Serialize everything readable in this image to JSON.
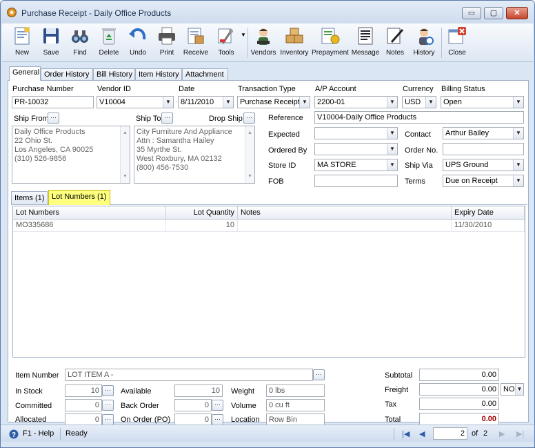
{
  "window": {
    "title": "Purchase Receipt - Daily Office Products",
    "min": "▭",
    "max": "▢",
    "close": "✕"
  },
  "toolbar": [
    {
      "label": "New",
      "icon": "new-document-icon"
    },
    {
      "label": "Save",
      "icon": "floppy-disk-icon"
    },
    {
      "label": "Find",
      "icon": "binoculars-icon"
    },
    {
      "label": "Delete",
      "icon": "recycle-bin-icon"
    },
    {
      "label": "Undo",
      "icon": "undo-arrow-icon"
    },
    {
      "label": "Print",
      "icon": "printer-icon"
    },
    {
      "label": "Receive",
      "icon": "receive-icon"
    },
    {
      "label": "Tools",
      "icon": "tools-icon"
    },
    {
      "label": "Vendors",
      "icon": "vendor-person-icon"
    },
    {
      "label": "Inventory",
      "icon": "boxes-icon"
    },
    {
      "label": "Prepayment",
      "icon": "prepayment-icon"
    },
    {
      "label": "Message",
      "icon": "message-icon"
    },
    {
      "label": "Notes",
      "icon": "notes-pen-icon"
    },
    {
      "label": "History",
      "icon": "history-person-icon"
    },
    {
      "label": "Close",
      "icon": "close-window-icon"
    }
  ],
  "tabs": [
    "General",
    "Order History",
    "Bill History",
    "Item History",
    "Attachment"
  ],
  "header": {
    "purchase_number_label": "Purchase Number",
    "purchase_number": "PR-10032",
    "vendor_id_label": "Vendor ID",
    "vendor_id": "V10004",
    "date_label": "Date",
    "date": "8/11/2010",
    "transaction_type_label": "Transaction Type",
    "transaction_type": "Purchase Receipt",
    "ap_account_label": "A/P Account",
    "ap_account": "2200-01",
    "currency_label": "Currency",
    "currency": "USD",
    "billing_status_label": "Billing Status",
    "billing_status": "Open"
  },
  "ship_from": {
    "label": "Ship From",
    "lines": [
      "Daily Office Products",
      "22 Ohio St.",
      "Los Angeles, CA 90025",
      "(310) 526-9856"
    ]
  },
  "ship_to": {
    "label": "Ship To",
    "lines": [
      "City Furniture And Appliance",
      "Attn : Samantha Hailey",
      "35 Myrthe St.",
      "West Roxbury, MA 02132",
      "(800) 456-7530"
    ]
  },
  "drop_ship_label": "Drop Ship",
  "details": {
    "reference_label": "Reference",
    "reference": "V10004-Daily Office Products",
    "expected_label": "Expected",
    "expected": "",
    "ordered_by_label": "Ordered By",
    "ordered_by": "",
    "store_id_label": "Store ID",
    "store_id": "MA STORE",
    "fob_label": "FOB",
    "fob": "",
    "contact_label": "Contact",
    "contact": "Arthur Bailey",
    "order_no_label": "Order No.",
    "order_no": "",
    "ship_via_label": "Ship Via",
    "ship_via": "UPS Ground",
    "terms_label": "Terms",
    "terms": "Due on Receipt"
  },
  "subtabs": [
    "Items (1)",
    "Lot Numbers (1)"
  ],
  "grid": {
    "columns": [
      "Lot Numbers",
      "Lot Quantity",
      "Notes",
      "Expiry Date"
    ],
    "rows": [
      [
        "MO335686",
        "10",
        "",
        "11/30/2010"
      ]
    ]
  },
  "item": {
    "item_number_label": "Item Number",
    "item_number": "LOT ITEM A -",
    "in_stock_label": "In Stock",
    "in_stock": "10",
    "committed_label": "Committed",
    "committed": "0",
    "allocated_label": "Allocated",
    "allocated": "0",
    "available_label": "Available",
    "available": "10",
    "back_order_label": "Back Order",
    "back_order": "0",
    "on_order_label": "On Order (PO)",
    "on_order": "0",
    "weight_label": "Weight",
    "weight": "0 lbs",
    "volume_label": "Volume",
    "volume": "0 cu ft",
    "location_label": "Location",
    "location": "Row  Bin"
  },
  "totals": {
    "subtotal_label": "Subtotal",
    "subtotal": "0.00",
    "freight_label": "Freight",
    "freight": "0.00",
    "freight_term": "NO",
    "tax_label": "Tax",
    "tax": "0.00",
    "total_label": "Total",
    "total": "0.00",
    "total_color": "#a00000"
  },
  "status": {
    "help": "F1 - Help",
    "state": "Ready",
    "page": "2",
    "of_label": "of",
    "total_pages": "2"
  }
}
